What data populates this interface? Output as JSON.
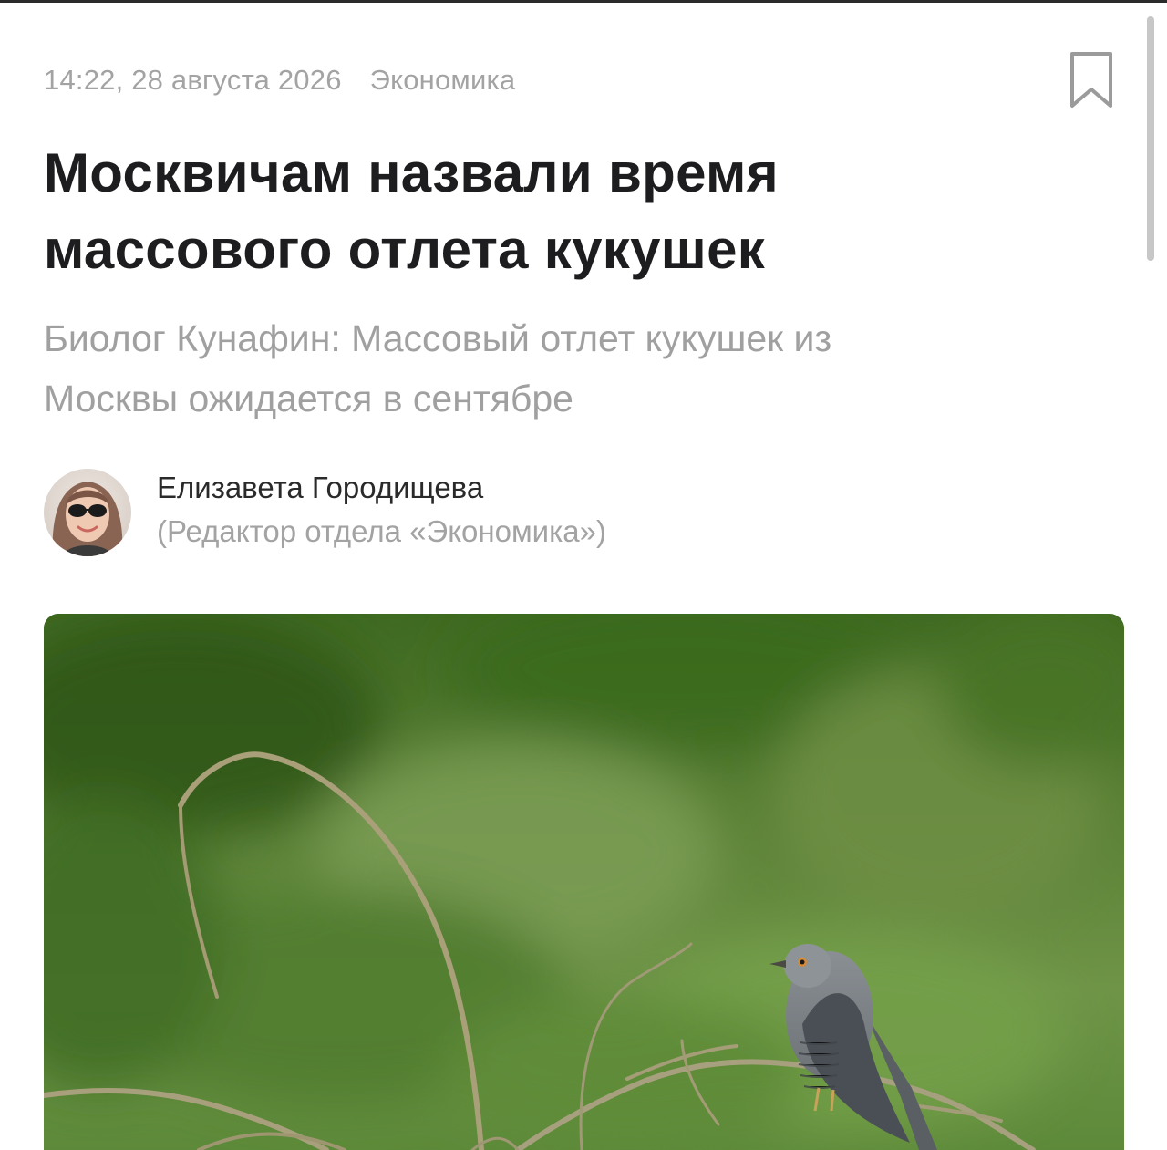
{
  "article": {
    "time": "14:22, 28 августа 2026",
    "category": "Экономика",
    "headline_line1": "Москвичам назвали время",
    "headline_line2": "массового отлета кукушек",
    "subtitle_line1": "Биолог Кунафин: Массовый отлет кукушек из",
    "subtitle_line2": "Москвы ожидается в сентябре"
  },
  "author": {
    "name": "Елизавета Городищева",
    "role": "(Редактор отдела «Экономика»)"
  },
  "icons": {
    "bookmark": "bookmark-icon"
  },
  "colors": {
    "headline": "#1d1d1f",
    "muted": "#a3a3a3",
    "photo_background": "#4f7a30"
  }
}
